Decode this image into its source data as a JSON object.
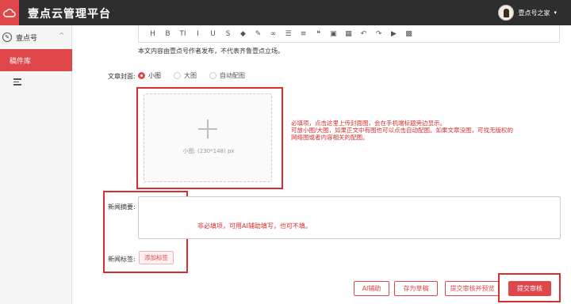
{
  "header": {
    "brand": "壹点云管理平台",
    "user_name": "壹点号之家",
    "caret": "▾"
  },
  "sidebar": {
    "section_label": "壹点号",
    "section_arrow": "^",
    "active_item": "稿件库"
  },
  "editor": {
    "toolbar": [
      "H",
      "B",
      "TI",
      "I",
      "U",
      "S",
      "◆",
      "✎",
      "∞",
      "☰",
      "≡",
      "❝",
      "▣",
      "▦",
      "↶",
      "↷",
      "▶",
      "▩"
    ],
    "notice": "本文内容由壹点号作者发布，不代表齐鲁壹点立场。"
  },
  "cover": {
    "label": "文章封面:",
    "options": [
      "小图",
      "大图",
      "自动配图"
    ],
    "selected": "小图",
    "upload_hint": "小图: (230*148) px",
    "note_lines": [
      "必填项，点击这里上传封面图，会在手机端标题旁边显示。",
      "可放小图/大图，如果正文中有图也可以点击自动配图。如果文章没图，可找无版权的",
      "网络图或者内容相关的配图。"
    ]
  },
  "summary": {
    "label": "新闻摘要:",
    "value": "",
    "note": "非必填项，可用AI辅助填写，也可不填。"
  },
  "tags": {
    "label": "新闻标签:",
    "add_button": "添加标签"
  },
  "actions": {
    "ai_assist": "AI辅助",
    "save_draft": "存为草稿",
    "submit_preview": "提交审核并预览",
    "submit": "提交审核"
  },
  "colors": {
    "accent": "#e0474b",
    "annotation": "#d92e2e",
    "topbar": "#2e2e2e"
  }
}
